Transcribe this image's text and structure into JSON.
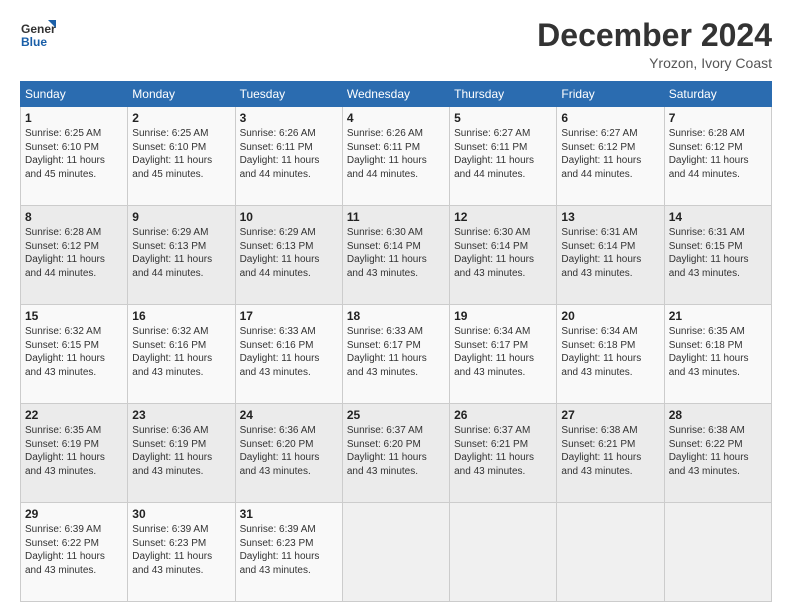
{
  "logo": {
    "line1": "General",
    "line2": "Blue"
  },
  "title": "December 2024",
  "subtitle": "Yrozon, Ivory Coast",
  "weekdays": [
    "Sunday",
    "Monday",
    "Tuesday",
    "Wednesday",
    "Thursday",
    "Friday",
    "Saturday"
  ],
  "weeks": [
    [
      {
        "day": "1",
        "sunrise": "6:25 AM",
        "sunset": "6:10 PM",
        "daylight": "11 hours and 45 minutes."
      },
      {
        "day": "2",
        "sunrise": "6:25 AM",
        "sunset": "6:10 PM",
        "daylight": "11 hours and 45 minutes."
      },
      {
        "day": "3",
        "sunrise": "6:26 AM",
        "sunset": "6:11 PM",
        "daylight": "11 hours and 44 minutes."
      },
      {
        "day": "4",
        "sunrise": "6:26 AM",
        "sunset": "6:11 PM",
        "daylight": "11 hours and 44 minutes."
      },
      {
        "day": "5",
        "sunrise": "6:27 AM",
        "sunset": "6:11 PM",
        "daylight": "11 hours and 44 minutes."
      },
      {
        "day": "6",
        "sunrise": "6:27 AM",
        "sunset": "6:12 PM",
        "daylight": "11 hours and 44 minutes."
      },
      {
        "day": "7",
        "sunrise": "6:28 AM",
        "sunset": "6:12 PM",
        "daylight": "11 hours and 44 minutes."
      }
    ],
    [
      {
        "day": "8",
        "sunrise": "6:28 AM",
        "sunset": "6:12 PM",
        "daylight": "11 hours and 44 minutes."
      },
      {
        "day": "9",
        "sunrise": "6:29 AM",
        "sunset": "6:13 PM",
        "daylight": "11 hours and 44 minutes."
      },
      {
        "day": "10",
        "sunrise": "6:29 AM",
        "sunset": "6:13 PM",
        "daylight": "11 hours and 44 minutes."
      },
      {
        "day": "11",
        "sunrise": "6:30 AM",
        "sunset": "6:14 PM",
        "daylight": "11 hours and 43 minutes."
      },
      {
        "day": "12",
        "sunrise": "6:30 AM",
        "sunset": "6:14 PM",
        "daylight": "11 hours and 43 minutes."
      },
      {
        "day": "13",
        "sunrise": "6:31 AM",
        "sunset": "6:14 PM",
        "daylight": "11 hours and 43 minutes."
      },
      {
        "day": "14",
        "sunrise": "6:31 AM",
        "sunset": "6:15 PM",
        "daylight": "11 hours and 43 minutes."
      }
    ],
    [
      {
        "day": "15",
        "sunrise": "6:32 AM",
        "sunset": "6:15 PM",
        "daylight": "11 hours and 43 minutes."
      },
      {
        "day": "16",
        "sunrise": "6:32 AM",
        "sunset": "6:16 PM",
        "daylight": "11 hours and 43 minutes."
      },
      {
        "day": "17",
        "sunrise": "6:33 AM",
        "sunset": "6:16 PM",
        "daylight": "11 hours and 43 minutes."
      },
      {
        "day": "18",
        "sunrise": "6:33 AM",
        "sunset": "6:17 PM",
        "daylight": "11 hours and 43 minutes."
      },
      {
        "day": "19",
        "sunrise": "6:34 AM",
        "sunset": "6:17 PM",
        "daylight": "11 hours and 43 minutes."
      },
      {
        "day": "20",
        "sunrise": "6:34 AM",
        "sunset": "6:18 PM",
        "daylight": "11 hours and 43 minutes."
      },
      {
        "day": "21",
        "sunrise": "6:35 AM",
        "sunset": "6:18 PM",
        "daylight": "11 hours and 43 minutes."
      }
    ],
    [
      {
        "day": "22",
        "sunrise": "6:35 AM",
        "sunset": "6:19 PM",
        "daylight": "11 hours and 43 minutes."
      },
      {
        "day": "23",
        "sunrise": "6:36 AM",
        "sunset": "6:19 PM",
        "daylight": "11 hours and 43 minutes."
      },
      {
        "day": "24",
        "sunrise": "6:36 AM",
        "sunset": "6:20 PM",
        "daylight": "11 hours and 43 minutes."
      },
      {
        "day": "25",
        "sunrise": "6:37 AM",
        "sunset": "6:20 PM",
        "daylight": "11 hours and 43 minutes."
      },
      {
        "day": "26",
        "sunrise": "6:37 AM",
        "sunset": "6:21 PM",
        "daylight": "11 hours and 43 minutes."
      },
      {
        "day": "27",
        "sunrise": "6:38 AM",
        "sunset": "6:21 PM",
        "daylight": "11 hours and 43 minutes."
      },
      {
        "day": "28",
        "sunrise": "6:38 AM",
        "sunset": "6:22 PM",
        "daylight": "11 hours and 43 minutes."
      }
    ],
    [
      {
        "day": "29",
        "sunrise": "6:39 AM",
        "sunset": "6:22 PM",
        "daylight": "11 hours and 43 minutes."
      },
      {
        "day": "30",
        "sunrise": "6:39 AM",
        "sunset": "6:23 PM",
        "daylight": "11 hours and 43 minutes."
      },
      {
        "day": "31",
        "sunrise": "6:39 AM",
        "sunset": "6:23 PM",
        "daylight": "11 hours and 43 minutes."
      },
      null,
      null,
      null,
      null
    ]
  ],
  "labels": {
    "sunrise": "Sunrise: ",
    "sunset": "Sunset: ",
    "daylight": "Daylight: "
  }
}
